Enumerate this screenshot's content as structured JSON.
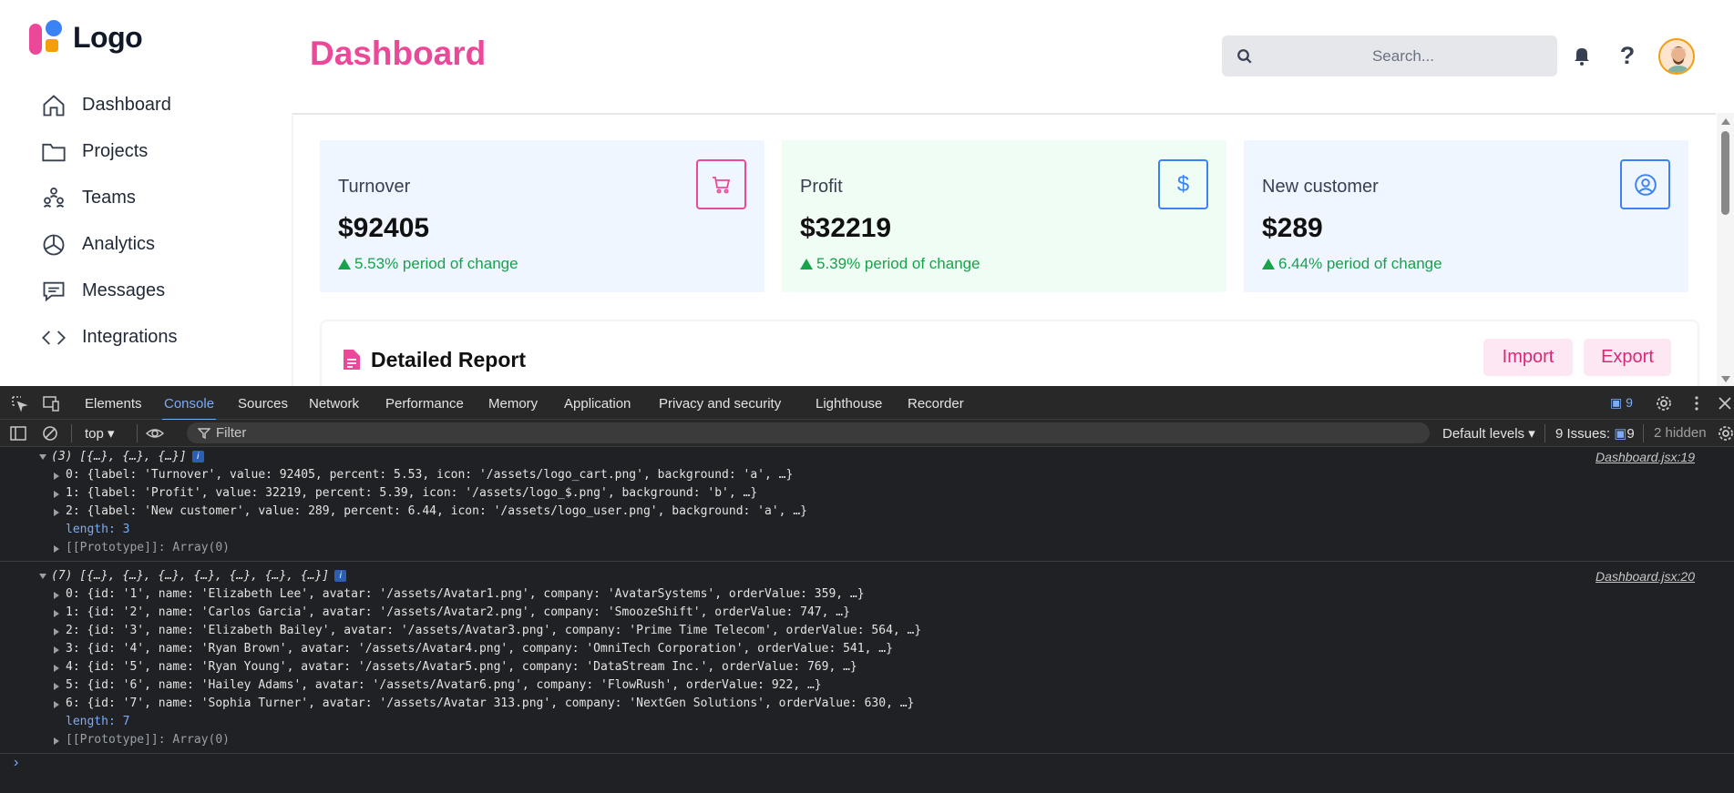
{
  "logo": {
    "text": "Logo"
  },
  "sidebar": {
    "items": [
      {
        "label": "Dashboard",
        "icon": "home-icon"
      },
      {
        "label": "Projects",
        "icon": "folder-icon"
      },
      {
        "label": "Teams",
        "icon": "teams-icon"
      },
      {
        "label": "Analytics",
        "icon": "pie-chart-icon"
      },
      {
        "label": "Messages",
        "icon": "message-icon"
      },
      {
        "label": "Integrations",
        "icon": "code-icon"
      }
    ]
  },
  "header": {
    "title": "Dashboard",
    "search_placeholder": "Search...",
    "help_glyph": "?"
  },
  "cards": [
    {
      "label": "Turnover",
      "value": "$92405",
      "change": "5.53% period of change",
      "icon": "cart-icon"
    },
    {
      "label": "Profit",
      "value": "$32219",
      "change": "5.39% period of change",
      "icon": "dollar-icon",
      "icon_glyph": "$"
    },
    {
      "label": "New customer",
      "value": "$289",
      "change": "6.44% period of change",
      "icon": "user-icon"
    }
  ],
  "report": {
    "title": "Detailed Report",
    "import_label": "Import",
    "export_label": "Export"
  },
  "devtools": {
    "tabs": [
      "Elements",
      "Console",
      "Sources",
      "Network",
      "Performance",
      "Memory",
      "Application",
      "Privacy and security",
      "Lighthouse",
      "Recorder"
    ],
    "active_tab": "Console",
    "issues_badge": "9",
    "context": "top",
    "filter_placeholder": "Filter",
    "levels": "Default levels",
    "issues_label": "9 Issues:",
    "issues_num": "9",
    "hidden": "2 hidden",
    "logs": [
      {
        "header": "(3) [{…}, {…}, {…}]",
        "source": "Dashboard.jsx:19",
        "items": [
          "0: {label: 'Turnover', value: 92405, percent: 5.53, icon: '/assets/logo_cart.png', background: 'a', …}",
          "1: {label: 'Profit', value: 32219, percent: 5.39, icon: '/assets/logo_$.png', background: 'b', …}",
          "2: {label: 'New customer', value: 289, percent: 6.44, icon: '/assets/logo_user.png', background: 'a', …}"
        ],
        "length": "length: 3",
        "proto": "[[Prototype]]: Array(0)"
      },
      {
        "header": "(7) [{…}, {…}, {…}, {…}, {…}, {…}, {…}]",
        "source": "Dashboard.jsx:20",
        "items": [
          "0: {id: '1', name: 'Elizabeth Lee', avatar: '/assets/Avatar1.png', company: 'AvatarSystems', orderValue: 359, …}",
          "1: {id: '2', name: 'Carlos Garcia', avatar: '/assets/Avatar2.png', company: 'SmoozeShift', orderValue: 747, …}",
          "2: {id: '3', name: 'Elizabeth Bailey', avatar: '/assets/Avatar3.png', company: 'Prime Time Telecom', orderValue: 564, …}",
          "3: {id: '4', name: 'Ryan Brown', avatar: '/assets/Avatar4.png', company: 'OmniTech Corporation', orderValue: 541, …}",
          "4: {id: '5', name: 'Ryan Young', avatar: '/assets/Avatar5.png', company: 'DataStream Inc.', orderValue: 769, …}",
          "5: {id: '6', name: 'Hailey Adams', avatar: '/assets/Avatar6.png', company: 'FlowRush', orderValue: 922, …}",
          "6: {id: '7', name: 'Sophia Turner', avatar: '/assets/Avatar 313.png', company: 'NextGen Solutions', orderValue: 630, …}"
        ],
        "length": "length: 7",
        "proto": "[[Prototype]]: Array(0)"
      }
    ],
    "prompt": "›"
  },
  "colors": {
    "accent": "#ec4899",
    "blue": "#3b82f6",
    "positive": "#16a34a"
  }
}
